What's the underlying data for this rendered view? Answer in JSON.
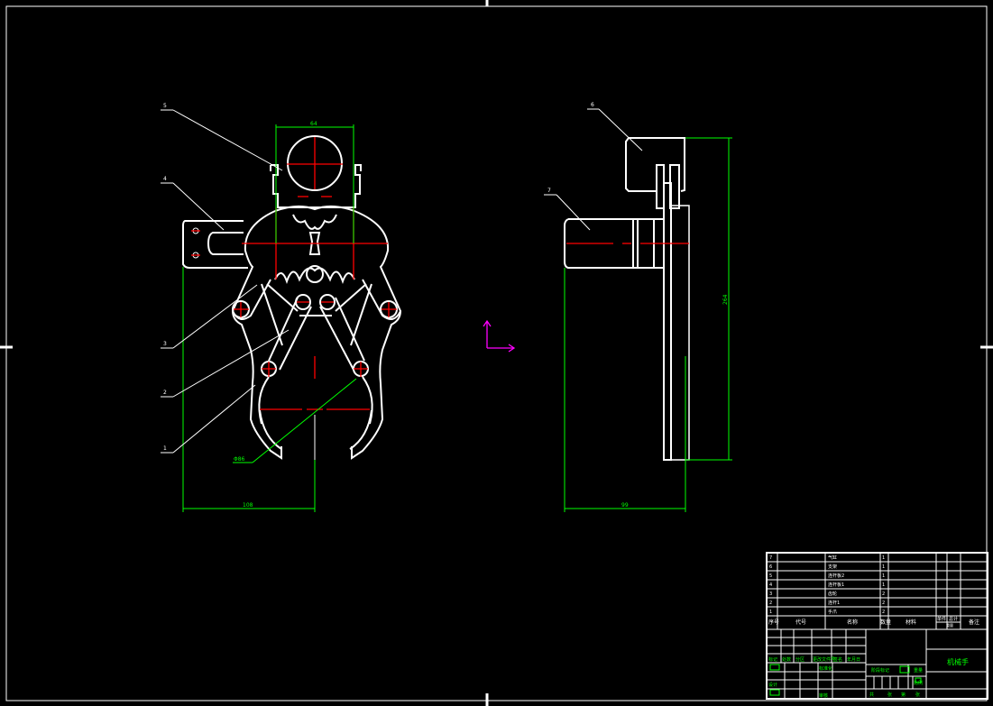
{
  "drawing": {
    "title": "机械手",
    "balloons": [
      "1",
      "2",
      "3",
      "4",
      "5",
      "6",
      "7"
    ],
    "dimensions": {
      "top_width": "64",
      "jaw_diameter": "Φ86",
      "front_width": "108",
      "side_height": "264",
      "side_width": "99"
    },
    "colors": {
      "background": "#000000",
      "outline": "#ffffff",
      "centerline": "#ff0000",
      "dimension": "#00ff00",
      "ucs": "#ff00ff"
    }
  },
  "parts_list": {
    "rows": [
      {
        "no": "7",
        "name": "气缸",
        "qty": "1"
      },
      {
        "no": "6",
        "name": "支架",
        "qty": "1"
      },
      {
        "no": "5",
        "name": "连杆板2",
        "qty": "1"
      },
      {
        "no": "4",
        "name": "连杆板1",
        "qty": "1"
      },
      {
        "no": "3",
        "name": "齿轮",
        "qty": "2"
      },
      {
        "no": "2",
        "name": "连杆1",
        "qty": "2"
      },
      {
        "no": "1",
        "name": "手爪",
        "qty": "2"
      }
    ],
    "headers": {
      "no": "序号",
      "code": "代号",
      "name": "名称",
      "qty": "数量",
      "material": "材料",
      "single": "单件",
      "total": "总计",
      "weight": "重量",
      "remark": "备注"
    }
  },
  "title_block": {
    "revision_headers": [
      "标记",
      "处数",
      "分区",
      "更改文件号",
      "签名",
      "年月日"
    ],
    "design": "设计",
    "standard": "标准化",
    "review": "审核",
    "process": "工艺",
    "approve": "批准",
    "stage": "阶段标记",
    "weight": "重量",
    "scale": "比例",
    "sheets": [
      "共",
      "张",
      "第",
      "张"
    ]
  }
}
